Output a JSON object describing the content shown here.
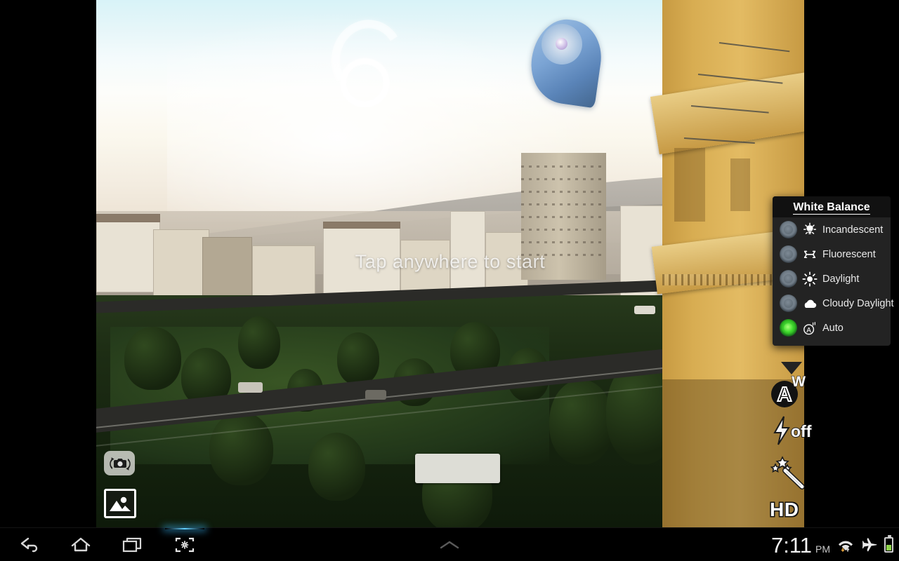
{
  "app": {
    "name": "Camera",
    "hint_text": "Tap anywhere to start"
  },
  "preview": {
    "scene_description": "city skyline at dusk with hills, buildings, park and road"
  },
  "left_controls": [
    {
      "name": "switch-camera-button",
      "icon": "camera-switch-icon",
      "label": ""
    },
    {
      "name": "gallery-button",
      "icon": "photo-thumbnail-icon",
      "label": ""
    }
  ],
  "right_controls": {
    "white_balance": {
      "icon": "auto-white-balance-icon",
      "label": "A",
      "superscript": "W"
    },
    "flash": {
      "icon": "flash-icon",
      "label": "off"
    },
    "effects": {
      "icon": "magic-wand-icon",
      "label": ""
    },
    "quality": {
      "icon": "hd-icon",
      "label": "HD"
    }
  },
  "white_balance_panel": {
    "title": "White Balance",
    "options": [
      {
        "label": "Incandescent",
        "icon": "incandescent-bulb-icon",
        "selected": false
      },
      {
        "label": "Fluorescent",
        "icon": "fluorescent-tube-icon",
        "selected": false
      },
      {
        "label": "Daylight",
        "icon": "sun-icon",
        "selected": false
      },
      {
        "label": "Cloudy Daylight",
        "icon": "cloud-icon",
        "selected": false
      },
      {
        "label": "Auto",
        "icon": "auto-a-icon",
        "selected": true
      }
    ],
    "selected_value": "Auto",
    "selected_color": "#3ddc2c",
    "unselected_color": "#6e7a85",
    "background_color": "#232323",
    "title_background": "#111111"
  },
  "navbar": {
    "buttons": [
      {
        "name": "back-button",
        "icon": "back-arrow-icon"
      },
      {
        "name": "home-button",
        "icon": "home-icon"
      },
      {
        "name": "recents-button",
        "icon": "recent-apps-icon"
      },
      {
        "name": "screenshot-button",
        "icon": "screenshot-icon",
        "highlighted": true
      }
    ],
    "expand_icon": "chevron-up-icon",
    "highlight_color": "#64d2ff"
  },
  "status_bar": {
    "time": "7:11",
    "meridiem": "PM",
    "icons": [
      {
        "name": "wifi-icon",
        "label": "wifi with data transfer arrows"
      },
      {
        "name": "airplane-icon",
        "label": "airplane mode"
      },
      {
        "name": "battery-icon",
        "label": "battery",
        "level_percent": 52,
        "color": "#8fd44a"
      }
    ]
  }
}
